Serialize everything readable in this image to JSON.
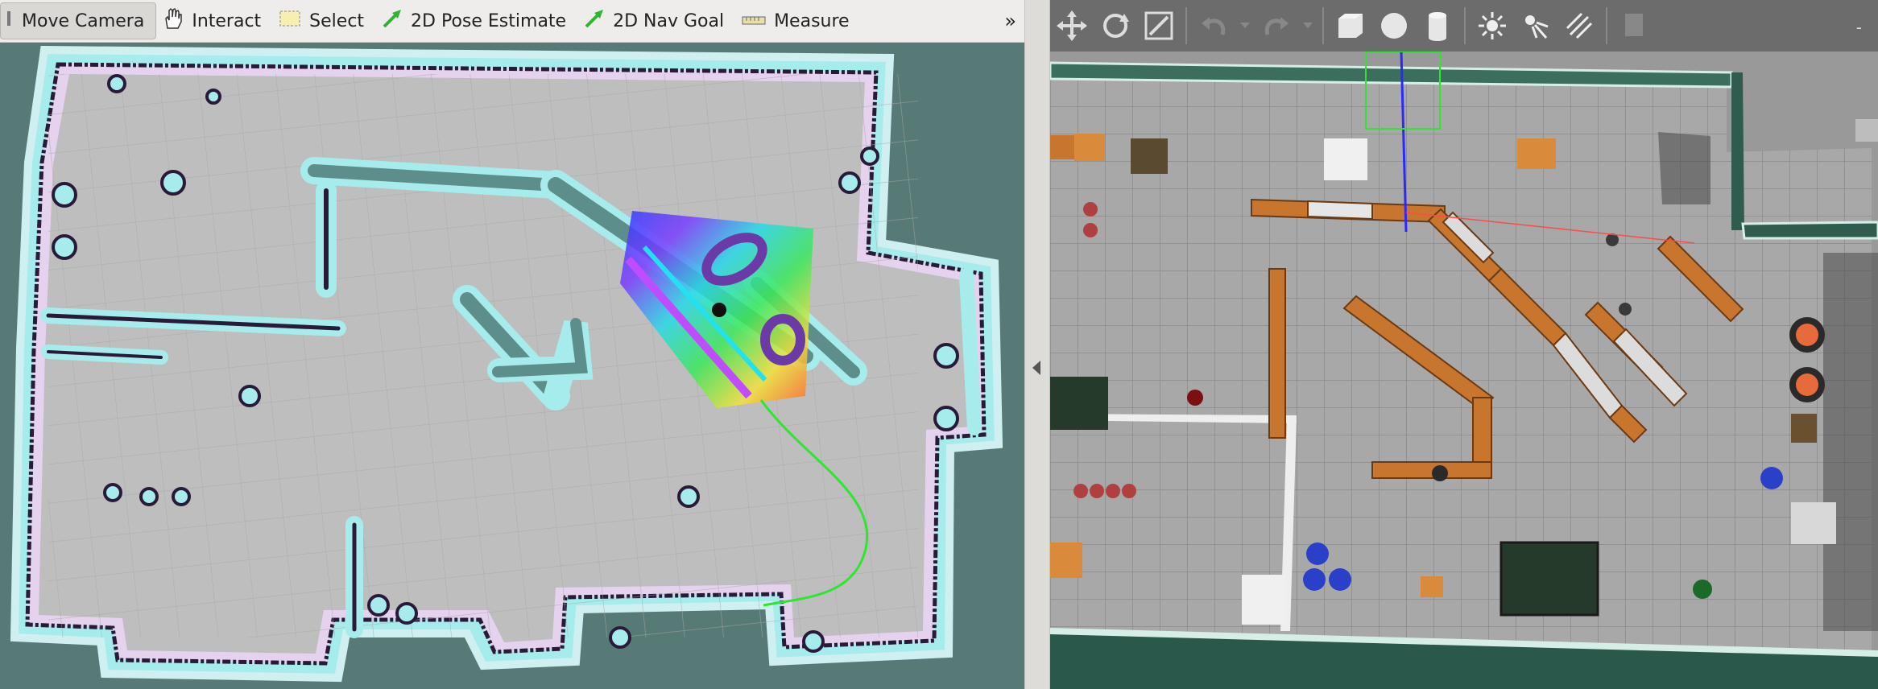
{
  "rviz": {
    "tools": [
      {
        "label": "Move Camera",
        "icon": "move-camera-icon"
      },
      {
        "label": "Interact",
        "icon": "hand-icon"
      },
      {
        "label": "Select",
        "icon": "select-box-icon"
      },
      {
        "label": "2D Pose Estimate",
        "icon": "green-arrow-icon"
      },
      {
        "label": "2D Nav Goal",
        "icon": "green-arrow-icon"
      },
      {
        "label": "Measure",
        "icon": "ruler-icon"
      }
    ],
    "more": "»",
    "colors": {
      "background": "#587a77",
      "free_space": "#bdbdbd",
      "inflation": "#9fe6e6",
      "obstacle": "#2a1a3a",
      "path": "#2ee62e"
    }
  },
  "gazebo": {
    "toolbar_icons": [
      "translate-icon",
      "rotate-icon",
      "scale-icon",
      "undo-icon",
      "redo-icon",
      "box-icon",
      "sphere-icon",
      "cylinder-icon",
      "point-light-icon",
      "spot-light-icon",
      "directional-light-icon",
      "copy-icon"
    ],
    "colors": {
      "floor": "#a5a5a5",
      "wall": "#3f6f5f",
      "shelf": "#c8762e"
    }
  }
}
